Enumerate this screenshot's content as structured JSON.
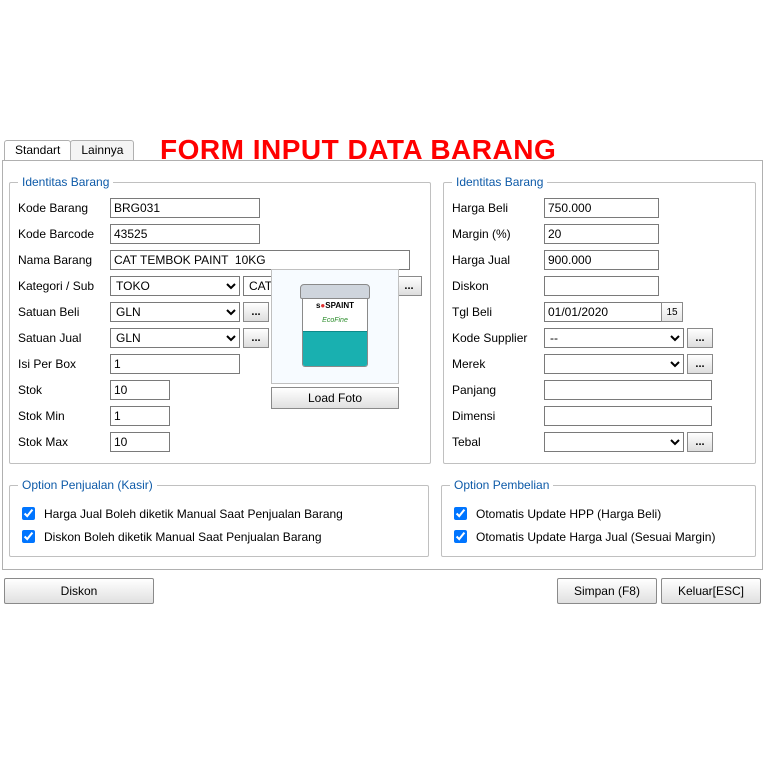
{
  "tabs": {
    "standart": "Standart",
    "lainnya": "Lainnya"
  },
  "title": "FORM  INPUT DATA BARANG",
  "group_identitas": "Identitas Barang",
  "left": {
    "labels": {
      "kode_barang": "Kode Barang",
      "kode_barcode": "Kode Barcode",
      "nama_barang": "Nama Barang",
      "kategori": "Kategori / Sub",
      "satuan_beli": "Satuan Beli",
      "satuan_jual": "Satuan Jual",
      "isi_per_box": "Isi Per Box",
      "stok": "Stok",
      "stok_min": "Stok Min",
      "stok_max": "Stok Max"
    },
    "values": {
      "kode_barang": "BRG031",
      "kode_barcode": "43525",
      "nama_barang": "CAT TEMBOK PAINT  10KG",
      "kategori": "TOKO",
      "sub_kategori": "CAT KB",
      "satuan_beli": "GLN",
      "satuan_jual": "GLN",
      "isi_per_box": "1",
      "stok": "10",
      "stok_min": "1",
      "stok_max": "10"
    }
  },
  "right": {
    "labels": {
      "harga_beli": "Harga Beli",
      "margin": "Margin (%)",
      "harga_jual": "Harga Jual",
      "diskon": "Diskon",
      "tgl_beli": "Tgl Beli",
      "kode_supplier": "Kode Supplier",
      "merek": "Merek",
      "panjang": "Panjang",
      "dimensi": "Dimensi",
      "tebal": "Tebal"
    },
    "values": {
      "harga_beli": "750.000",
      "margin": "20",
      "harga_jual": "900.000",
      "diskon": "",
      "tgl_beli": "01/01/2020",
      "kode_supplier": "--",
      "merek": "",
      "panjang": "",
      "dimensi": "",
      "tebal": ""
    }
  },
  "photo": {
    "load_label": "Load Foto",
    "brand_prefix": "s",
    "brand_dot": "●",
    "brand_suffix": "SPAINT",
    "subbrand": "EcoFine"
  },
  "options_penjualan": {
    "legend": "Option Penjualan (Kasir)",
    "opt1": "Harga Jual Boleh diketik Manual Saat Penjualan Barang",
    "opt2": "Diskon Boleh diketik Manual Saat Penjualan Barang"
  },
  "options_pembelian": {
    "legend": "Option Pembelian",
    "opt1": "Otomatis Update HPP (Harga Beli)",
    "opt2": "Otomatis Update Harga Jual (Sesuai Margin)"
  },
  "footer": {
    "diskon": "Diskon",
    "simpan": "Simpan (F8)",
    "keluar": "Keluar[ESC]"
  },
  "ellipsis": "...",
  "date_icon": "15"
}
